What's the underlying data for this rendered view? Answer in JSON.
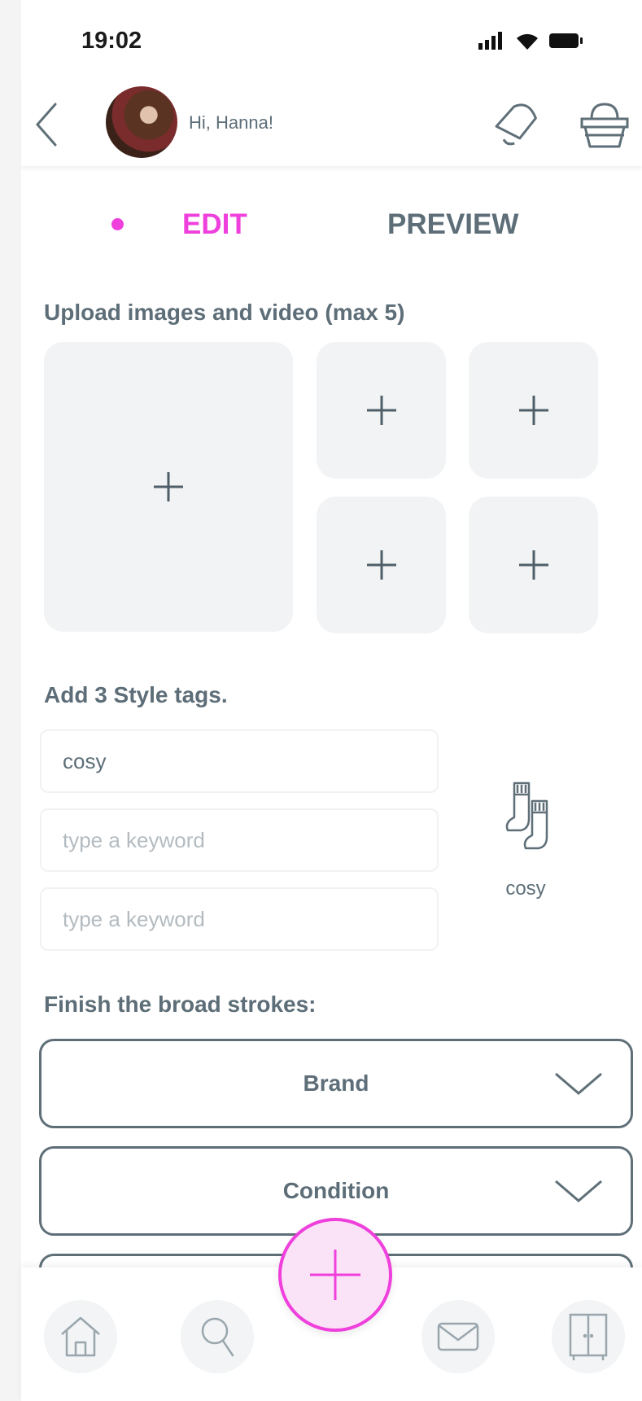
{
  "status_bar": {
    "time": "19:02"
  },
  "header": {
    "greeting": "Hi, Hanna!"
  },
  "tabs": {
    "edit": "EDIT",
    "preview": "PREVIEW",
    "active": "EDIT"
  },
  "upload": {
    "title": "Upload images and video (max 5)",
    "slot_icon": "plus-icon"
  },
  "style_tags": {
    "title": "Add 3 Style tags.",
    "inputs": [
      {
        "value": "cosy",
        "placeholder": ""
      },
      {
        "value": "",
        "placeholder": "type a keyword"
      },
      {
        "value": "",
        "placeholder": "type a keyword"
      }
    ],
    "preview_icon": "socks-icon",
    "preview_label": "cosy"
  },
  "broad_strokes": {
    "title": "Finish the broad strokes:",
    "dropdowns": [
      {
        "label": "Brand"
      },
      {
        "label": "Condition"
      },
      {
        "label": ""
      }
    ]
  },
  "bottom_nav": {
    "items": [
      "home-icon",
      "search-icon",
      "add-icon",
      "mail-icon",
      "wardrobe-icon"
    ]
  },
  "colors": {
    "accent": "#ef3fdc",
    "text": "#5d6e78",
    "tile": "#f1f3f4"
  }
}
